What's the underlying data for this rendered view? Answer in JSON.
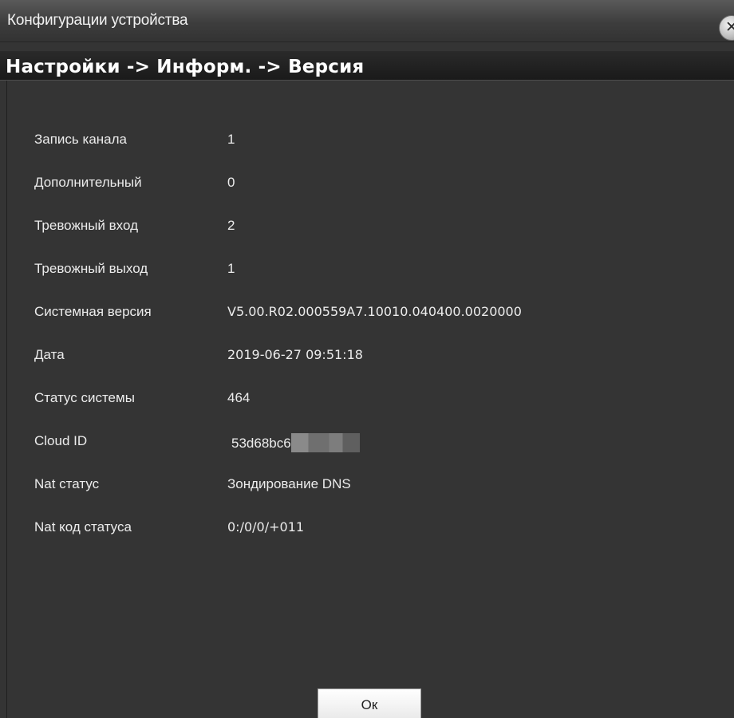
{
  "window": {
    "title": "Конфигурации устройства",
    "close_glyph": "✕"
  },
  "breadcrumb": "Настройки -> Информ. -> Версия",
  "rows": [
    {
      "label": "Запись канала",
      "value": "1"
    },
    {
      "label": "Дополнительный",
      "value": "0"
    },
    {
      "label": "Тревожный вход",
      "value": "2"
    },
    {
      "label": "Тревожный выход",
      "value": "1"
    },
    {
      "label": "Системная версия",
      "value": "V5.00.R02.000559A7.10010.040400.0020000"
    },
    {
      "label": "Дата",
      "value": "2019-06-27 09:51:18"
    },
    {
      "label": "Статус системы",
      "value": "464"
    },
    {
      "label": "Cloud ID",
      "value": "53d68bc6"
    },
    {
      "label": "Nat статус",
      "value": "Зондирование DNS"
    },
    {
      "label": "Nat код статуса",
      "value": "0:/0/0/+011"
    }
  ],
  "ok_label": "Ок",
  "colors": {
    "background": "#343434",
    "text": "#ececec"
  }
}
